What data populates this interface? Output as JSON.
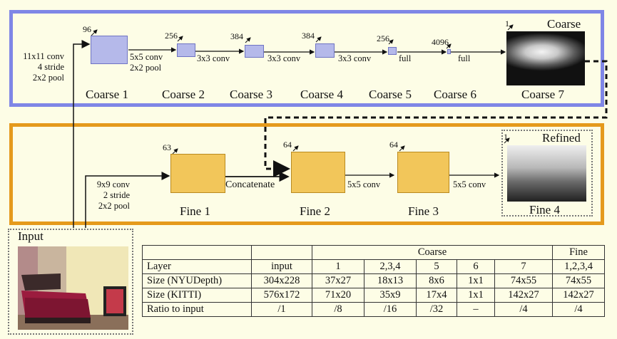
{
  "coarse": {
    "layers": [
      {
        "name": "Coarse 1",
        "size": "96"
      },
      {
        "name": "Coarse 2",
        "size": "256"
      },
      {
        "name": "Coarse 3",
        "size": "384"
      },
      {
        "name": "Coarse 4",
        "size": "384"
      },
      {
        "name": "Coarse 5",
        "size": "256"
      },
      {
        "name": "Coarse 6",
        "size": "4096"
      },
      {
        "name": "Coarse 7",
        "size": "1"
      }
    ],
    "output_label": "Coarse",
    "ops": {
      "input_op": [
        "11x11 conv",
        "4 stride",
        "2x2 pool"
      ],
      "op12": [
        "5x5 conv",
        "2x2 pool"
      ],
      "op23": "3x3 conv",
      "op34": "3x3 conv",
      "op45": "3x3 conv",
      "op56": "full",
      "op67": "full"
    }
  },
  "fine": {
    "layers": [
      {
        "name": "Fine 1",
        "size": "63"
      },
      {
        "name": "Fine 2",
        "size": "64"
      },
      {
        "name": "Fine 3",
        "size": "64"
      },
      {
        "name": "Fine 4",
        "size": "1"
      }
    ],
    "output_label": "Refined",
    "ops": {
      "input_op": [
        "9x9 conv",
        "2 stride",
        "2x2 pool"
      ],
      "concat": "Concatenate",
      "op23": "5x5 conv",
      "op34": "5x5 conv"
    }
  },
  "input_label": "Input",
  "table": {
    "group_header": [
      "",
      "",
      "Coarse",
      "Fine"
    ],
    "rows": [
      [
        "Layer",
        "input",
        "1",
        "2,3,4",
        "5",
        "6",
        "7",
        "1,2,3,4"
      ],
      [
        "Size (NYUDepth)",
        "304x228",
        "37x27",
        "18x13",
        "8x6",
        "1x1",
        "74x55",
        "74x55"
      ],
      [
        "Size (KITTI)",
        "576x172",
        "71x20",
        "35x9",
        "17x4",
        "1x1",
        "142x27",
        "142x27"
      ],
      [
        "Ratio to input",
        "/1",
        "/8",
        "/16",
        "/32",
        "–",
        "/4",
        "/4"
      ]
    ]
  },
  "colors": {
    "coarse_border": "#7f86e6",
    "fine_border": "#e59a1c",
    "background": "#fdfde6"
  }
}
